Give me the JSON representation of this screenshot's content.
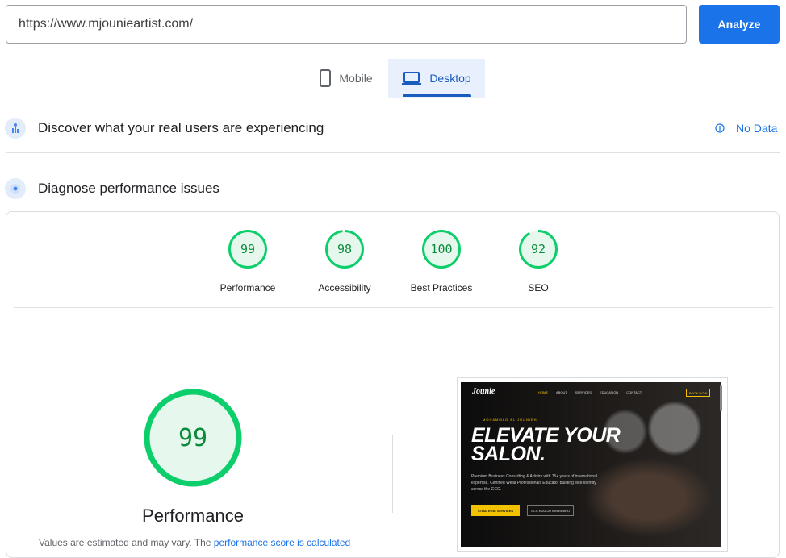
{
  "url_bar": {
    "value": "https://www.mjounieartist.com/",
    "analyze_label": "Analyze"
  },
  "tabs": [
    {
      "label": "Mobile",
      "icon": "phone-icon",
      "selected": false
    },
    {
      "label": "Desktop",
      "icon": "laptop-icon",
      "selected": true
    }
  ],
  "field_data": {
    "title": "Discover what your real users are experiencing",
    "status": "No Data",
    "icon": "users-icon"
  },
  "lab_data": {
    "title": "Diagnose performance issues",
    "icon": "lab-icon"
  },
  "scores": [
    {
      "label": "Performance",
      "value": 99
    },
    {
      "label": "Accessibility",
      "value": 98
    },
    {
      "label": "Best Practices",
      "value": 100
    },
    {
      "label": "SEO",
      "value": 92
    }
  ],
  "performance": {
    "score": 99,
    "label": "Performance",
    "note_prefix": "Values are estimated and may vary. The ",
    "note_link": "performance score is calculated"
  },
  "colors": {
    "pass_green": "#0cce6b",
    "pass_fill": "#e6f8ed",
    "accent_blue": "#1a73e8"
  },
  "screenshot": {
    "logo": "Jounie",
    "nav": [
      "HOME",
      "ABOUT",
      "SERVICES",
      "EDUCATION",
      "CONTACT"
    ],
    "book_label": "BOOK NOW",
    "eyebrow": "MOHAMMAD AL JOUNIEH",
    "headline": "ELEVATE YOUR SALON.",
    "body": "Premium Business Consulting & Artistry with 15+ years of international expertise. Certified Wella Professionals Educator building elite identity across the GCC.",
    "cta_primary": "STRATEGIC SERVICES",
    "cta_secondary": "GCC EDUCATION BRAND"
  }
}
